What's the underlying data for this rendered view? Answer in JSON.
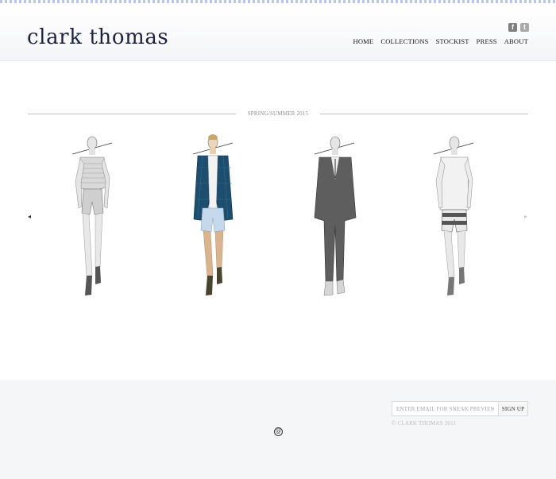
{
  "brand": {
    "logo": "clark thomas"
  },
  "social": [
    {
      "name": "facebook",
      "glyph": "f"
    },
    {
      "name": "twitter",
      "glyph": "t"
    }
  ],
  "nav": {
    "items": [
      "HOME",
      "COLLECTIONS",
      "STOCKIST",
      "PRESS",
      "ABOUT"
    ]
  },
  "collection": {
    "season": "SPRING/SUMMER 2015",
    "prev_glyph": "◂",
    "next_glyph": "▸",
    "looks": [
      {
        "name": "striped polo with grey shorts",
        "top": "#d9d9d9",
        "bottom": "#cfcfcf"
      },
      {
        "name": "navy plaid blazer with light blue shorts",
        "top": "#1d4e6e",
        "bottom": "#c6d9ec"
      },
      {
        "name": "charcoal suit",
        "top": "#5e5e5e",
        "bottom": "#5e5e5e"
      },
      {
        "name": "white shirt with striped shorts",
        "top": "#f2f2f2",
        "bottom": "#555555"
      }
    ]
  },
  "footer": {
    "email_placeholder": "ENTER EMAIL FOR SNEAK PREVIEW",
    "signup_label": "SIGN UP",
    "copyright": "© CLARK THOMAS 2011",
    "at_glyph": "@"
  }
}
